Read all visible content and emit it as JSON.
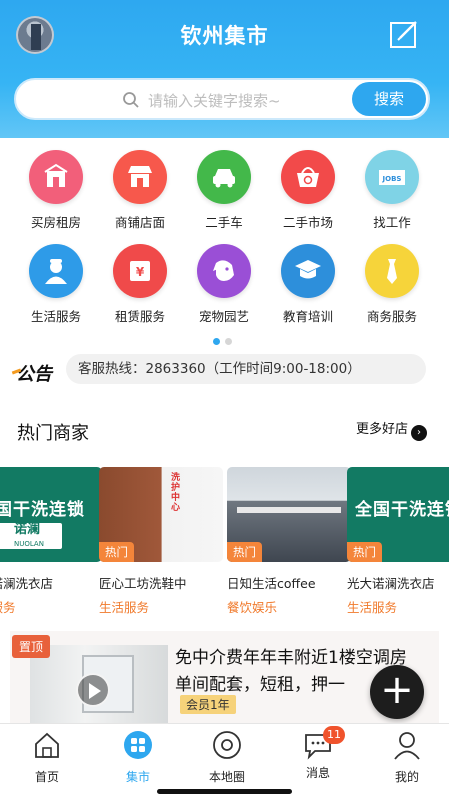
{
  "header": {
    "title": "钦州集市",
    "search_placeholder": "请输入关键字搜索~",
    "search_button": "搜索"
  },
  "categories": [
    {
      "label": "买房租房",
      "icon": "house-icon",
      "color": "#f25f7a"
    },
    {
      "label": "商铺店面",
      "icon": "shop-icon",
      "color": "#f7584c"
    },
    {
      "label": "二手车",
      "icon": "car-icon",
      "color": "#43b84a"
    },
    {
      "label": "二手市场",
      "icon": "basket-icon",
      "color": "#f24a4a"
    },
    {
      "label": "找工作",
      "icon": "jobs-icon",
      "color": "#7fd3e6"
    },
    {
      "label": "生活服务",
      "icon": "worker-icon",
      "color": "#2e9be8"
    },
    {
      "label": "租赁服务",
      "icon": "ticket-icon",
      "color": "#f04a4a"
    },
    {
      "label": "宠物园艺",
      "icon": "dog-icon",
      "color": "#9a4fd6"
    },
    {
      "label": "教育培训",
      "icon": "graduation-icon",
      "color": "#2d8fdb"
    },
    {
      "label": "商务服务",
      "icon": "tie-icon",
      "color": "#f6d43a"
    }
  ],
  "notice": {
    "logo": "公告",
    "text": "客服热线：2863360（工作时间9:00-18:00）"
  },
  "hot_merchants": {
    "title": "热门商家",
    "more": "更多好店",
    "cards": [
      {
        "name": "大诺澜洗衣店",
        "category": "活服务",
        "tag": "",
        "brand_big": "国干洗连锁",
        "brand_sub": "诺澜",
        "brand_sub_small": "NUOLAN"
      },
      {
        "name": "匠心工坊洗鞋中",
        "category": "生活服务",
        "tag": "热门"
      },
      {
        "name": "日知生活coffee",
        "category": "餐饮娱乐",
        "tag": "热门"
      },
      {
        "name": "光大诺澜洗衣店",
        "category": "生活服务",
        "tag": "热门",
        "brand_big": "全国干洗连锁"
      }
    ]
  },
  "post": {
    "top_tag": "置顶",
    "title": "免中介费年年丰附近1楼空调房单间配套，短租，押一",
    "member": "会员1年"
  },
  "tabs": [
    {
      "label": "首页",
      "icon": "home-icon"
    },
    {
      "label": "集市",
      "icon": "market-icon",
      "active": true
    },
    {
      "label": "本地圈",
      "icon": "local-circle-icon"
    },
    {
      "label": "消息",
      "icon": "message-icon",
      "badge": "11"
    },
    {
      "label": "我的",
      "icon": "profile-icon"
    }
  ],
  "colors": {
    "accent": "#2ea7ef",
    "tag_orange": "#f4853a",
    "category_text": "#f07a2c"
  }
}
